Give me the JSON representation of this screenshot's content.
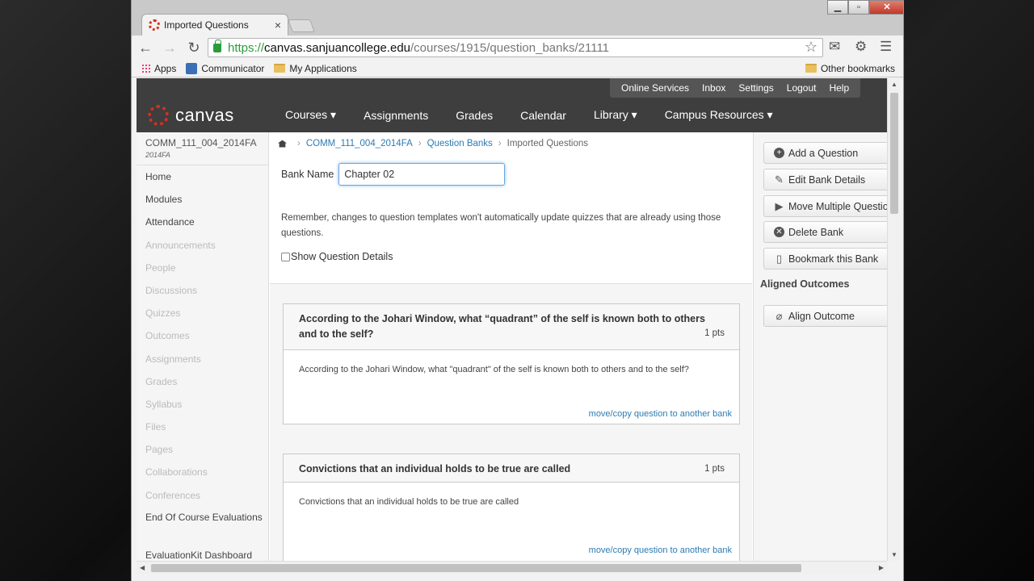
{
  "browser": {
    "tab_title": "Imported Questions",
    "tab_close": "×",
    "url_scheme": "https://",
    "url_host": "canvas.sanjuancollege.edu",
    "url_path": "/courses/1915/question_banks/21111",
    "bookmarks": [
      "Apps",
      "Communicator",
      "My Applications"
    ],
    "other_bookmarks": "Other bookmarks",
    "accent_green": "#2a9d3a"
  },
  "canvas": {
    "logo_text": "canvas",
    "brand_color": "#d7301f",
    "util_links": [
      "Online Services",
      "Inbox",
      "Settings",
      "Logout",
      "Help"
    ],
    "nav": [
      "Courses ▾",
      "Assignments",
      "Grades",
      "Calendar",
      "Library ▾",
      "Campus Resources ▾"
    ]
  },
  "course": {
    "name": "COMM_111_004_2014FA",
    "term": "2014FA",
    "nav": [
      {
        "label": "Home",
        "active": true
      },
      {
        "label": "Modules",
        "active": true
      },
      {
        "label": "Attendance",
        "active": true
      },
      {
        "label": "Announcements",
        "active": false
      },
      {
        "label": "People",
        "active": false
      },
      {
        "label": "Discussions",
        "active": false
      },
      {
        "label": "Quizzes",
        "active": false
      },
      {
        "label": "Outcomes",
        "active": false
      },
      {
        "label": "Assignments",
        "active": false
      },
      {
        "label": "Grades",
        "active": false
      },
      {
        "label": "Syllabus",
        "active": false
      },
      {
        "label": "Files",
        "active": false
      },
      {
        "label": "Pages",
        "active": false
      },
      {
        "label": "Collaborations",
        "active": false
      },
      {
        "label": "Conferences",
        "active": false
      },
      {
        "label": "End Of Course Evaluations",
        "active": true
      },
      {
        "label": "EvaluationKit Dashboard",
        "active": true
      }
    ]
  },
  "breadcrumb": {
    "course": "COMM_111_004_2014FA",
    "banks": "Question Banks",
    "current": "Imported Questions",
    "sep": "›"
  },
  "bank": {
    "label": "Bank Name",
    "value": "Chapter 02",
    "notice": "Remember, changes to question templates won't automatically update quizzes that are already using those questions.",
    "show_details": "Show Question Details"
  },
  "questions": [
    {
      "title": "According to the Johari Window, what “quadrant” of the self is known both to others and to the self?",
      "points": "1 pts",
      "text": "According to the Johari Window, what \"quadrant\" of the self is known both to others and to the self?",
      "link": "move/copy question to another bank"
    },
    {
      "title": "Convictions that an individual holds to be true are called",
      "points": "1 pts",
      "text": "Convictions that an individual holds to be true are called",
      "link": "move/copy question to another bank"
    }
  ],
  "sidebar": {
    "add_question": "Add a Question",
    "edit_bank": "Edit Bank Details",
    "move_multiple": "Move Multiple Questions",
    "delete_bank": "Delete Bank",
    "bookmark_bank": "Bookmark this Bank",
    "aligned_outcomes": "Aligned Outcomes",
    "align_outcome": "Align Outcome"
  }
}
